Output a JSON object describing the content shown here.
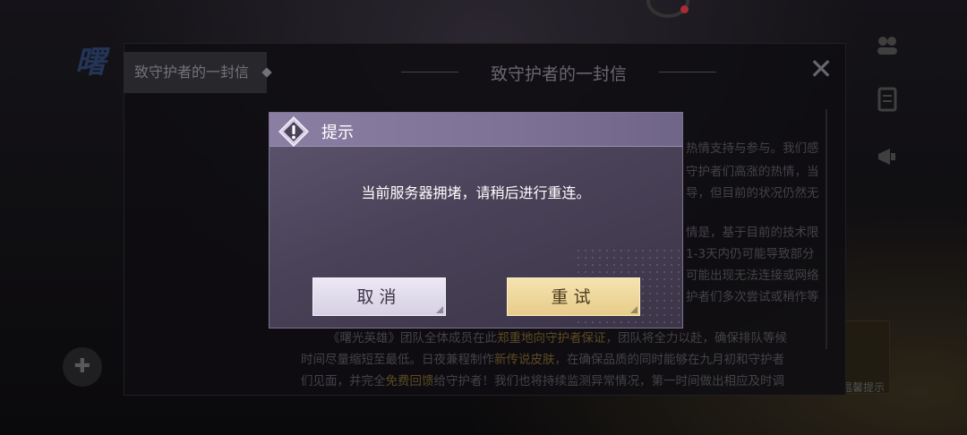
{
  "background": {
    "game_logo": "曙",
    "bottom_right_label": "温馨提示"
  },
  "letter": {
    "tab_label": "致守护者的一封信",
    "title": "致守护者的一封信",
    "close_icon": "close-icon",
    "right_fragments": [
      "热情支持与参与。我们感",
      "守护者们高涨的热情，当",
      "导，但目前的状况仍然无",
      "情是，基于目前的技术限",
      "1-3天内仍可能导致部分",
      "可能出现无法连接或网络",
      "护者们多次尝试或稍作等"
    ],
    "bottom_lines": [
      {
        "before": "《曙光英雄》团队全体成员在此",
        "highlight": "郑重地向守护者保证",
        "after": "，团队将全力以赴，确保排队等候"
      },
      {
        "before": "时间尽量缩短至最低。日夜兼程制作",
        "highlight": "新传说皮肤",
        "after": "，在确保品质的同时能够在九月初和守护者"
      },
      {
        "before": "们见面，并完全",
        "highlight": "免费回馈",
        "after": "给守护者！我们也将持续监测异常情况，第一时间做出相应及时调"
      }
    ]
  },
  "dialog": {
    "title": "提示",
    "icon": "warning-icon",
    "message": "当前服务器拥堵，请稍后进行重连。",
    "cancel_label": "取消",
    "retry_label": "重试",
    "colors": {
      "header": "#8a7fa2",
      "body": "#4a4258",
      "cancel_button": "#e2ddeb",
      "retry_button": "#efd89c"
    }
  }
}
